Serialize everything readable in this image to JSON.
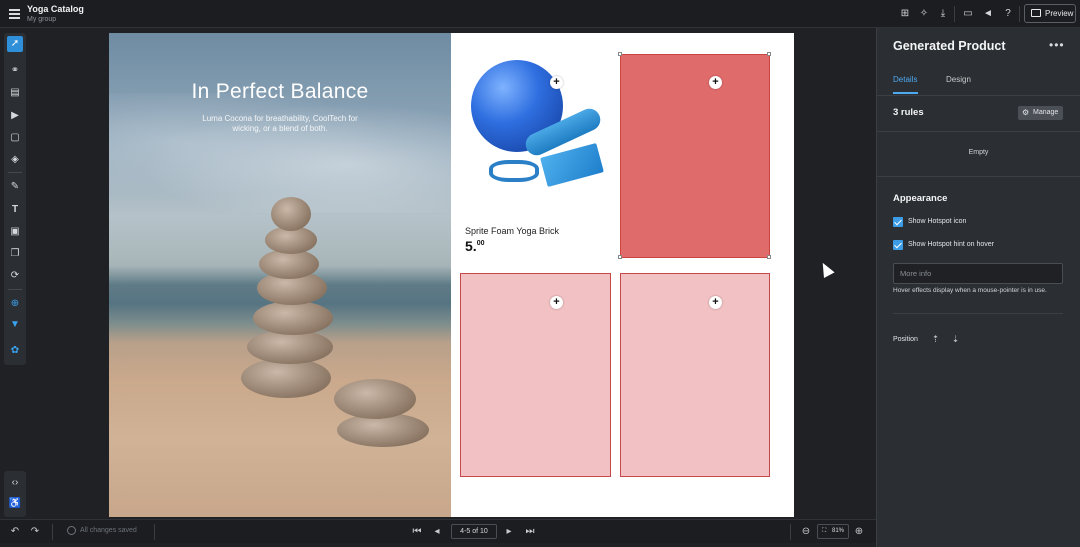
{
  "app": {
    "title": "Yoga Catalog",
    "subtitle": "My group"
  },
  "topbar": {
    "preview_label": "Preview"
  },
  "hero": {
    "title": "In Perfect Balance",
    "subtitle": "Luma Cocona for breathability, CoolTech for wicking, or a blend of both."
  },
  "product": {
    "name": "Sprite Foam Yoga Brick",
    "price_main": "5.",
    "price_cents": "00"
  },
  "bottombar": {
    "saved_label": "All changes saved",
    "page_range": "4-5 of 10",
    "zoom": "81%"
  },
  "panel": {
    "title": "Generated Product",
    "tabs": [
      {
        "label": "Details"
      },
      {
        "label": "Design"
      }
    ],
    "rules_label": "3 rules",
    "manage_label": "Manage",
    "empty_label": "Empty",
    "appearance_label": "Appearance",
    "show_icon_label": "Show Hotspot icon",
    "show_hint_label": "Show Hotspot hint on hover",
    "more_info_placeholder": "More info",
    "hint_text": "Hover effects display when a mouse-pointer is in use.",
    "position_label": "Position"
  },
  "colors": {
    "accent": "#3c9de6",
    "hotspot_selected": "#e06b6b",
    "hotspot": "#f2c1c3"
  }
}
